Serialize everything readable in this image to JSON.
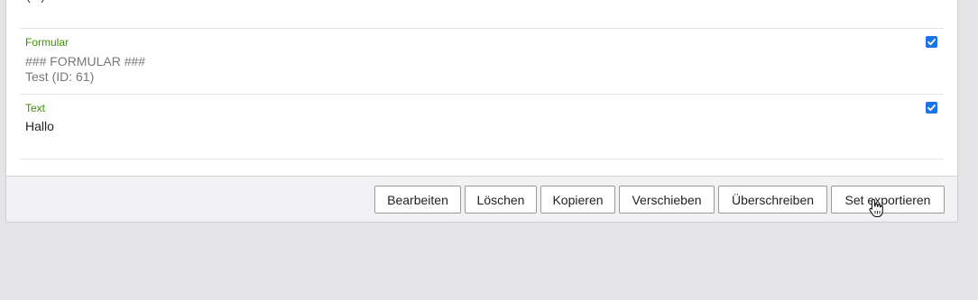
{
  "top_partial_text": "(...) ...",
  "items": [
    {
      "type_label": "Formular",
      "lines": [
        "### FORMULAR ###",
        "Test (ID: 61)"
      ],
      "checked": true
    },
    {
      "type_label": "Text",
      "lines": [
        "Hallo"
      ],
      "checked": true
    }
  ],
  "footer": {
    "buttons": {
      "edit": "Bearbeiten",
      "delete": "Löschen",
      "copy": "Kopieren",
      "move": "Verschieben",
      "overwrite": "Überschreiben",
      "export": "Set exportieren"
    }
  },
  "colors": {
    "type_label": "#3f8f00",
    "checkbox": "#1a73e8",
    "background": "#e5e5e7"
  }
}
